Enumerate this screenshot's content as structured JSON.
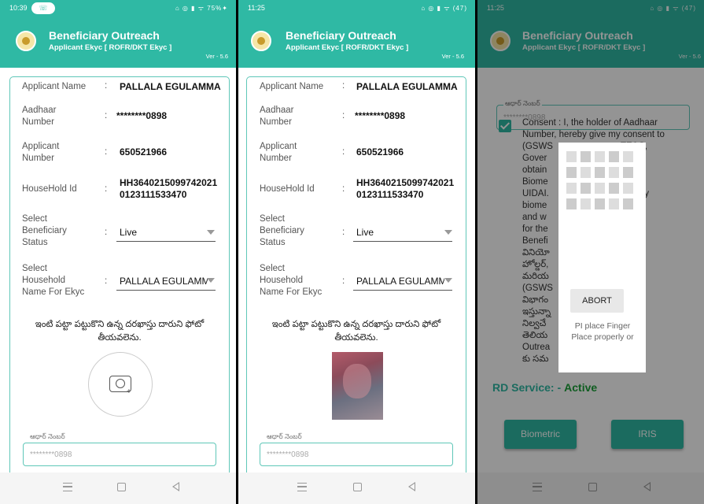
{
  "screens": [
    {
      "status": {
        "time": "10:39",
        "call_icon": "phone-icon",
        "icons": "⌂ ◎ ▮ ᯤ 75%✦"
      },
      "app": {
        "title": "Beneficiary Outreach",
        "subtitle": "Applicant Ekyc [ ROFR/DKT Ekyc ]",
        "version": "Ver - 5.6"
      },
      "fields": [
        {
          "label": "Applicant Name",
          "colon": ":",
          "value": "PALLALA EGULAMMA"
        },
        {
          "label_1": "Aadhaar",
          "label_2": "Number",
          "colon": ":",
          "value": "********0898"
        },
        {
          "label_1": "Applicant",
          "label_2": "Number",
          "colon": ":",
          "value": "650521966"
        },
        {
          "label": "HouseHold Id",
          "colon": ":",
          "value_1": "HH3640215099742021",
          "value_2": "0123111533470"
        },
        {
          "label_1": "Select",
          "label_2": "Beneficiary",
          "label_3": "Status",
          "colon": ":",
          "value": "Live"
        },
        {
          "label_1": "Select",
          "label_2": "Household",
          "label_3": "Name For Ekyc",
          "colon": ":",
          "value": "PALLALA EGULAMMA"
        }
      ],
      "instruction_1": "ఇంటి పట్టా పట్టుకొని ఉన్న దరఖాస్తు దారుని ఫోటో",
      "instruction_2": "తీయవలెను.",
      "aadhaar_label": "ఆధార్ నెంబర్",
      "aadhaar_value": "********0898"
    },
    {
      "status": {
        "time": "11:25",
        "icons": "⌂ ◎ ▮ ᯤ (47)"
      },
      "app": {
        "title": "Beneficiary Outreach",
        "subtitle": "Applicant Ekyc [ ROFR/DKT Ekyc ]",
        "version": "Ver - 5.6"
      },
      "fields": [
        {
          "label": "Applicant Name",
          "colon": ":",
          "value": "PALLALA EGULAMMA"
        },
        {
          "label_1": "Aadhaar",
          "label_2": "Number",
          "colon": ":",
          "value": "********0898"
        },
        {
          "label_1": "Applicant",
          "label_2": "Number",
          "colon": ":",
          "value": "650521966"
        },
        {
          "label": "HouseHold Id",
          "colon": ":",
          "value_1": "HH3640215099742021",
          "value_2": "0123111533470"
        },
        {
          "label_1": "Select",
          "label_2": "Beneficiary",
          "label_3": "Status",
          "colon": ":",
          "value": "Live"
        },
        {
          "label_1": "Select",
          "label_2": "Household",
          "label_3": "Name For Ekyc",
          "colon": ":",
          "value": "PALLALA EGULAMMA"
        }
      ],
      "instruction_1": "ఇంటి పట్టా పట్టుకొని ఉన్న దరఖాస్తు దారుని ఫోటో",
      "instruction_2": "తీయవలెను.",
      "aadhaar_label": "ఆధార్ నెంబర్",
      "aadhaar_value": "********0898"
    },
    {
      "status": {
        "time": "11:25",
        "icons": "⌂ ◎ ▮ ᯤ (47)"
      },
      "app": {
        "title": "Beneficiary Outreach",
        "subtitle": "Applicant Ekyc [ ROFR/DKT Ekyc ]",
        "version": "Ver - 5.6"
      },
      "aadhaar_label": "ఆధార్ నెంబర్",
      "aadhaar_value": "********0898",
      "consent_lines": [
        "Consent : I, the holder of Aadhaar",
        "Number, hereby give my consent to",
        "(GSWS                           TE&C,",
        "Gover                          desh to",
        "obtain                          r and",
        "Biome                          with",
        "UIDAI.                       ed that my",
        "biome                      d/shared",
        "and w                        DR only",
        "for the                      cation in",
        "Benefi",
        "వినియో                  ార్ నంబర్",
        "హోల్డర్,                     బర్",
        "మరియ                    పొందటానికి",
        "(GSWS                  టి ఇ & సి",
        "విభాగం                  ా సమ్మతి",
        "ఇస్తున్నా                   మెట్రిక్",
        "నిల్వచే                    చేయబడదని",
        "తెలియ                  iary",
        "Outrea               మాత్రమే CIDR",
        "కు సమ"
      ],
      "rd_label": "RD Service: -",
      "rd_status": "Active",
      "biometric_label": "Biometric",
      "iris_label": "IRIS",
      "dialog": {
        "abort_label": "ABORT",
        "message_1": "PI place Finger",
        "message_2": "Place properly or"
      }
    }
  ],
  "colors": {
    "primary": "#2fb9a4",
    "active": "#1aa037",
    "border": "#5fc7b8"
  }
}
